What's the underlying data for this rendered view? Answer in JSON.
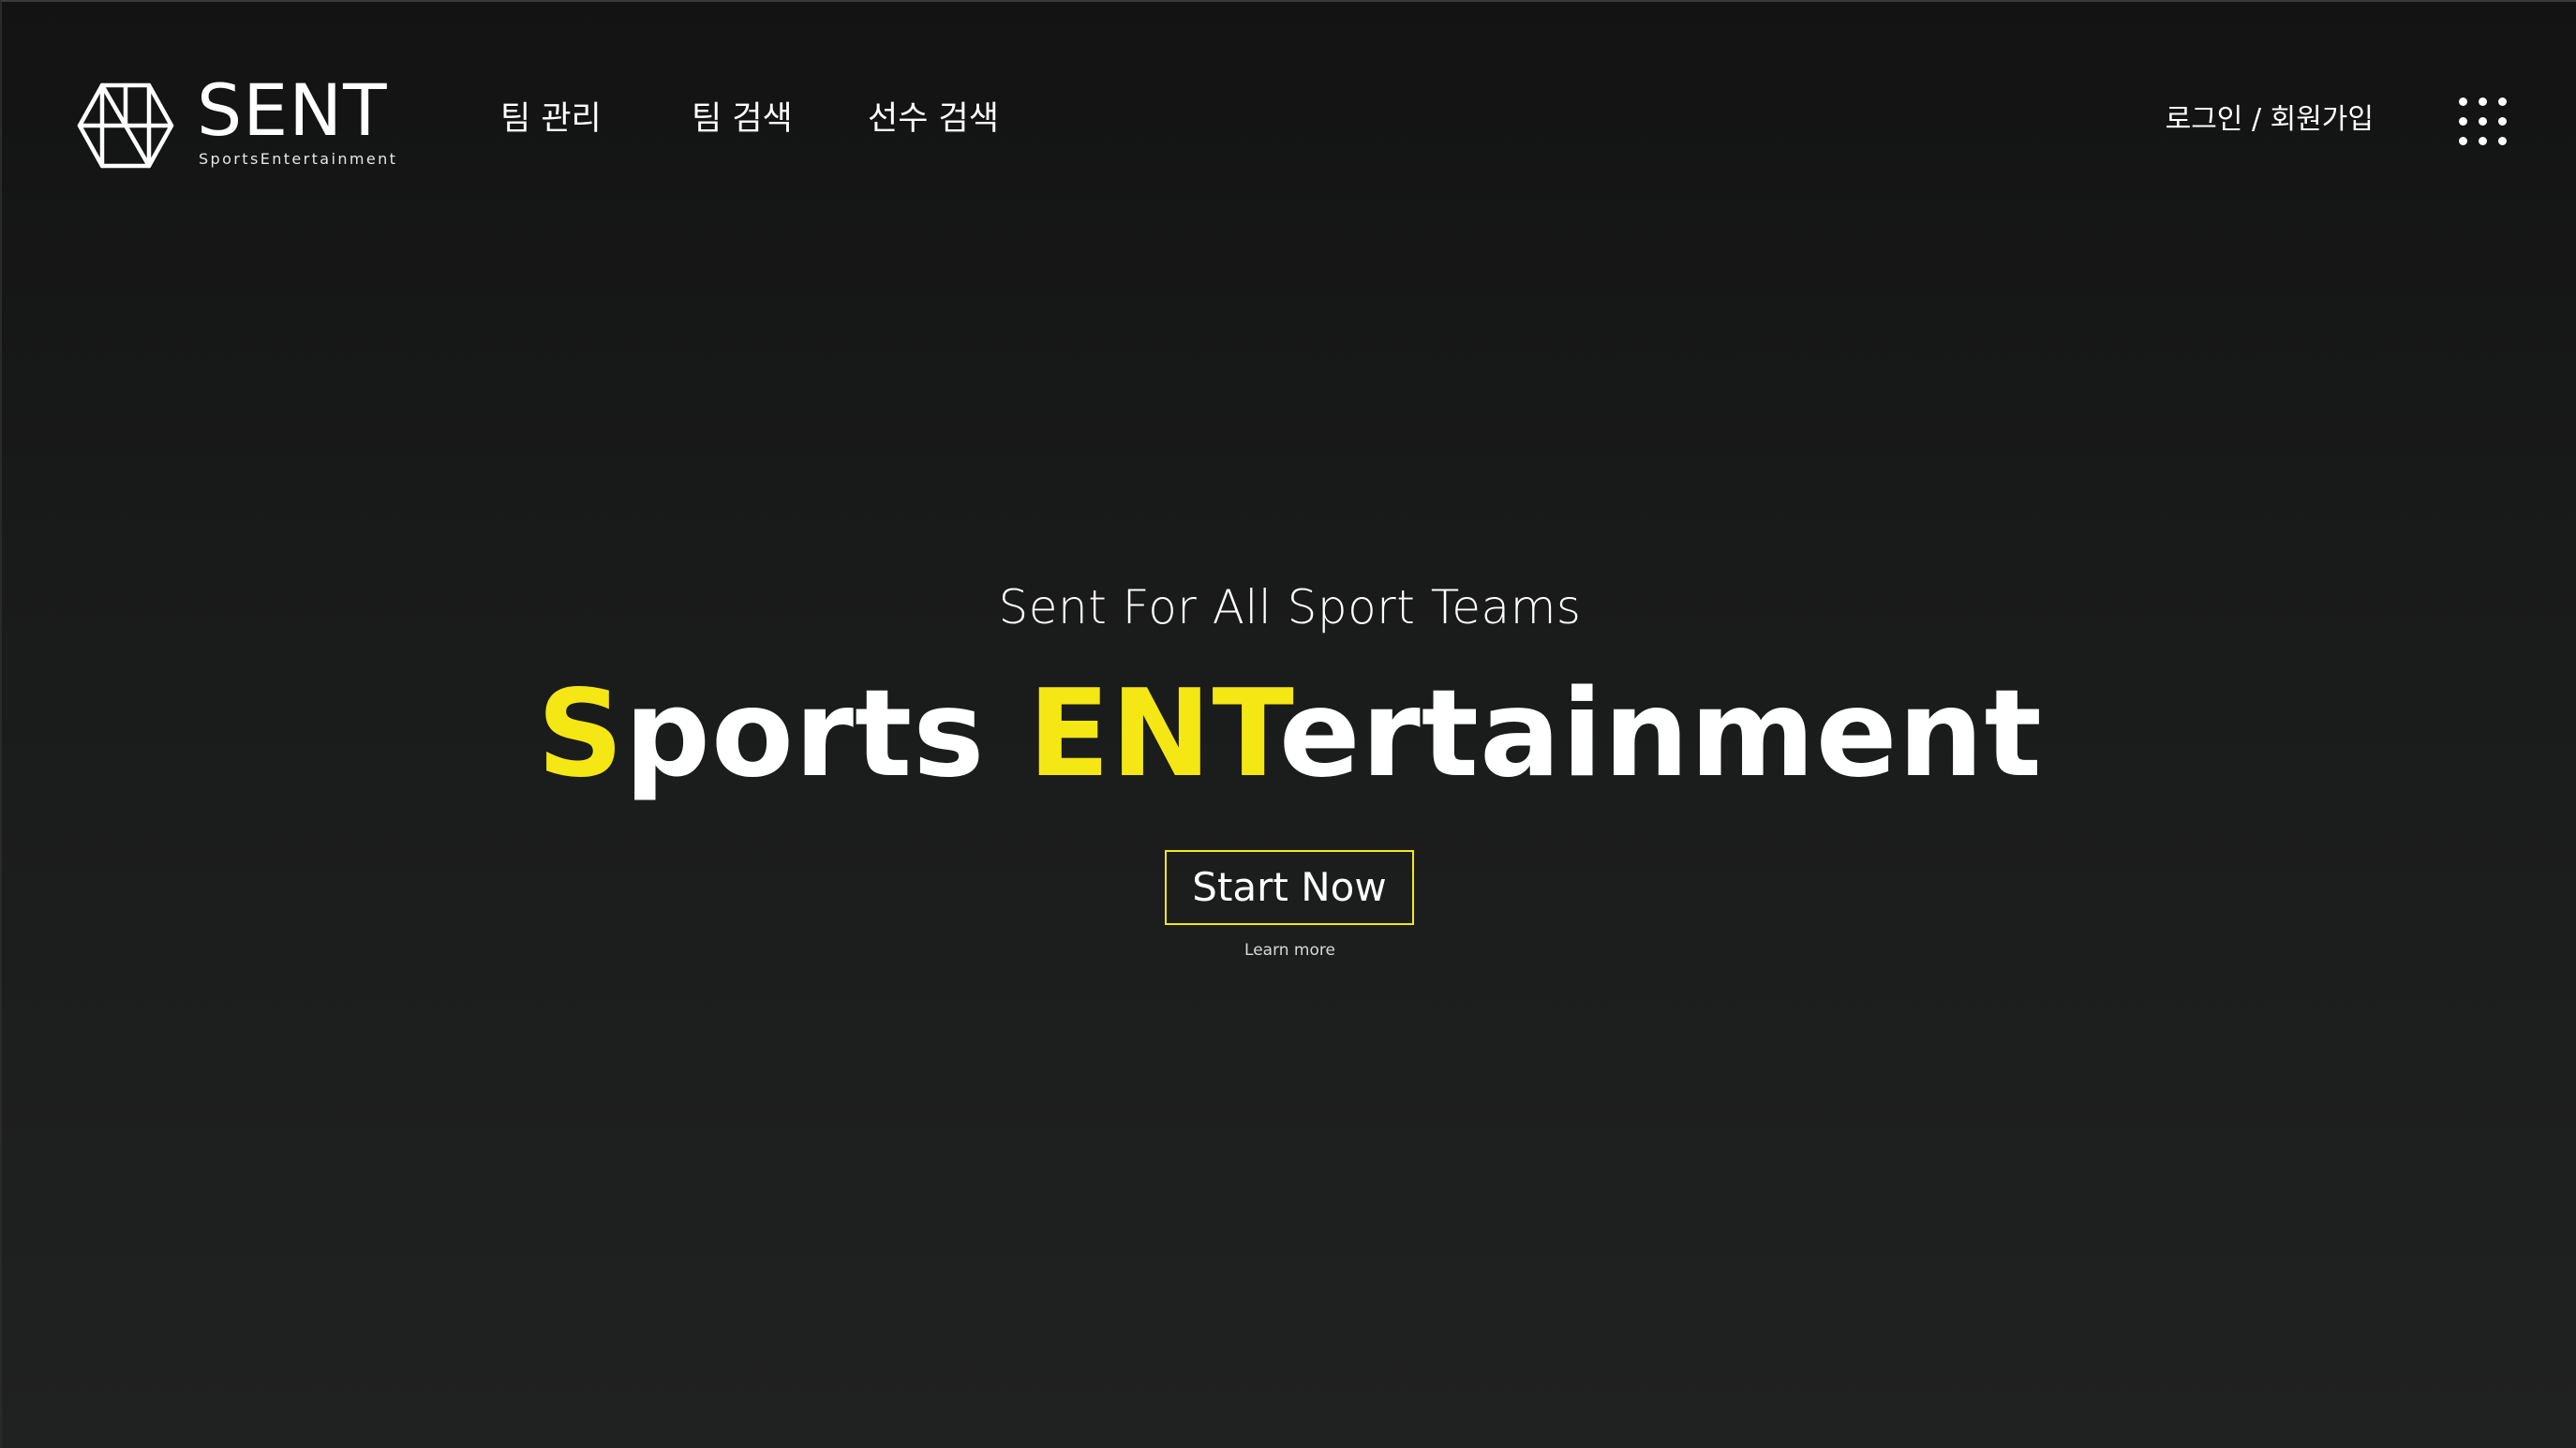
{
  "theme": {
    "background": "#151515",
    "text": "#ffffff",
    "accent": "#f4e714"
  },
  "header": {
    "logo": {
      "icon": "sent-geometric-logo-icon",
      "wordmark": "SENT",
      "tagline": "SportsEntertainment"
    },
    "nav": [
      {
        "label": "팀 관리"
      },
      {
        "label": "팀 검색"
      },
      {
        "label": "선수 검색"
      }
    ],
    "auth_label": "로그인 / 회원가입",
    "menu_icon": "grid-dots-icon"
  },
  "hero": {
    "kicker": "Sent For All Sport Teams",
    "title_parts": [
      {
        "text": "S",
        "accent": true
      },
      {
        "text": "ports ",
        "accent": false
      },
      {
        "text": "ENT",
        "accent": true
      },
      {
        "text": "ertainment",
        "accent": false
      }
    ],
    "cta_label": "Start Now",
    "learn_more": "Learn more"
  }
}
